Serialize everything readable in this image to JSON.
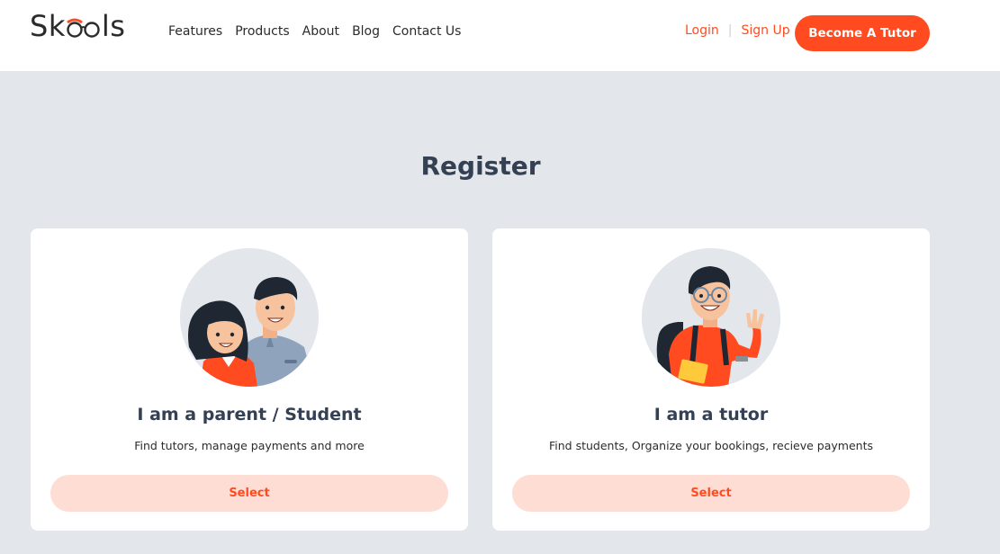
{
  "header": {
    "logo_text_start": "Sk",
    "logo_text_end": "ls",
    "nav": [
      "Features",
      "Products",
      "About",
      "Blog",
      "Contact Us"
    ],
    "login_label": "Login",
    "signup_label": "Sign Up",
    "become_tutor_label": "Become A Tutor"
  },
  "main": {
    "title": "Register",
    "cards": [
      {
        "title": "I am a parent / Student",
        "description": "Find tutors, manage payments and more",
        "button_label": "Select",
        "avatar_icon": "parent-student-illustration"
      },
      {
        "title": "I am a tutor",
        "description": "Find students, Organize your bookings, recieve payments",
        "button_label": "Select",
        "avatar_icon": "tutor-illustration"
      }
    ]
  },
  "colors": {
    "accent": "#ff4b1f",
    "accent_light": "#fdddd4",
    "background": "#e3e7ec",
    "text": "#344054"
  }
}
